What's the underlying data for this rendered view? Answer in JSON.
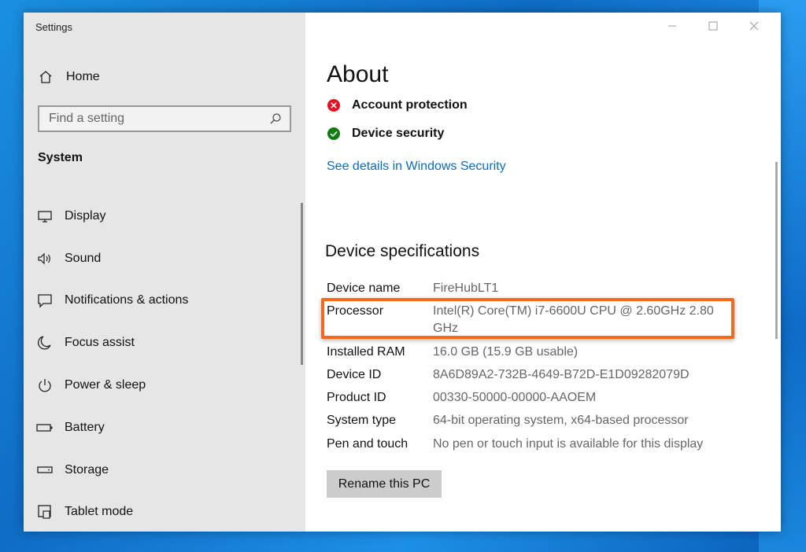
{
  "window": {
    "title": "Settings",
    "controls": [
      "minimize-icon",
      "maximize-icon",
      "close-icon"
    ]
  },
  "sidebar": {
    "home_label": "Home",
    "home_icon": "home-icon",
    "search_placeholder": "Find a setting",
    "search_icon": "search-icon",
    "section": "System",
    "items": [
      {
        "label": "Display",
        "icon": "display-icon"
      },
      {
        "label": "Sound",
        "icon": "speaker-icon"
      },
      {
        "label": "Notifications & actions",
        "icon": "notification-icon"
      },
      {
        "label": "Focus assist",
        "icon": "moon-icon"
      },
      {
        "label": "Power & sleep",
        "icon": "power-icon"
      },
      {
        "label": "Battery",
        "icon": "battery-icon"
      },
      {
        "label": "Storage",
        "icon": "storage-icon"
      },
      {
        "label": "Tablet mode",
        "icon": "tablet-mode-icon"
      }
    ]
  },
  "main": {
    "title": "About",
    "security": [
      {
        "label": "Account protection",
        "status": "error",
        "icon": "error-x-icon",
        "color": "#e81123"
      },
      {
        "label": "Device security",
        "status": "ok",
        "icon": "checkmark-icon",
        "color": "#107c10"
      }
    ],
    "security_link": "See details in Windows Security",
    "specs_heading": "Device specifications",
    "specs": [
      {
        "label": "Device name",
        "value": "FireHubLT1"
      },
      {
        "label": "Processor",
        "value": "Intel(R) Core(TM) i7-6600U CPU @ 2.60GHz   2.80 GHz"
      },
      {
        "label": "Installed RAM",
        "value": "16.0 GB (15.9 GB usable)"
      },
      {
        "label": "Device ID",
        "value": "8A6D89A2-732B-4649-B72D-E1D09282079D"
      },
      {
        "label": "Product ID",
        "value": "00330-50000-00000-AAOEM"
      },
      {
        "label": "System type",
        "value": "64-bit operating system, x64-based processor"
      },
      {
        "label": "Pen and touch",
        "value": "No pen or touch input is available for this display"
      }
    ],
    "rename_button": "Rename this PC",
    "highlight_color": "#f2691f",
    "link_color": "#0b6cc8"
  }
}
